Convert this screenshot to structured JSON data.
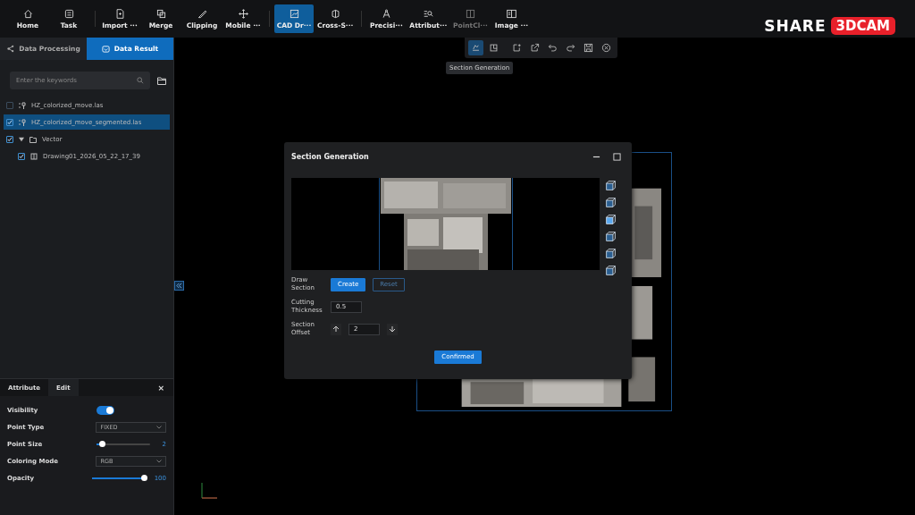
{
  "toolbar": {
    "groups": [
      {
        "items": [
          {
            "label": "Home",
            "selected": false,
            "disabled": false
          },
          {
            "label": "Task",
            "selected": false,
            "disabled": false
          }
        ]
      },
      {
        "items": [
          {
            "label": "Import ···",
            "selected": false,
            "disabled": false
          },
          {
            "label": "Merge",
            "selected": false,
            "disabled": false
          },
          {
            "label": "Clipping",
            "selected": false,
            "disabled": false
          },
          {
            "label": "Mobile ···",
            "selected": false,
            "disabled": false
          }
        ]
      },
      {
        "items": [
          {
            "label": "CAD Dr···",
            "selected": true,
            "disabled": false
          },
          {
            "label": "Cross-S···",
            "selected": false,
            "disabled": false
          }
        ]
      },
      {
        "items": [
          {
            "label": "Precisi···",
            "selected": false,
            "disabled": false
          },
          {
            "label": "Attribut···",
            "selected": false,
            "disabled": false
          },
          {
            "label": "PointCl···",
            "selected": false,
            "disabled": true
          },
          {
            "label": "Image ···",
            "selected": false,
            "disabled": false
          }
        ]
      }
    ]
  },
  "logo": {
    "name": "SHARE",
    "badge": "3DCAM"
  },
  "left_panel": {
    "tabs": [
      {
        "label": "Data Processing",
        "selected": false
      },
      {
        "label": "Data Result",
        "selected": true
      }
    ],
    "search": {
      "placeholder": "Enter the keywords"
    },
    "tree": [
      {
        "label": "HZ_colorized_move.las",
        "kind": "cloud",
        "checked": false,
        "selected": false
      },
      {
        "label": "HZ_colorized_move_segmented.las",
        "kind": "cloud",
        "checked": true,
        "selected": true
      },
      {
        "label": "Vector",
        "kind": "folder",
        "checked": true,
        "selected": false,
        "expanded": true,
        "children": [
          {
            "label": "Drawing01_2026_05_22_17_39",
            "kind": "drawing",
            "checked": true,
            "selected": false
          }
        ]
      }
    ]
  },
  "properties": {
    "tabs": [
      {
        "label": "Attribute",
        "selected": false
      },
      {
        "label": "Edit",
        "selected": true
      }
    ],
    "close": "×",
    "rows": [
      {
        "label": "Visibility",
        "kind": "toggle",
        "on": true
      },
      {
        "label": "Point Type",
        "kind": "select",
        "value": "FIXED"
      },
      {
        "label": "Point Size",
        "kind": "slider",
        "level": 0.1,
        "reading": "2"
      },
      {
        "label": "Coloring Mode",
        "kind": "select",
        "value": "RGB"
      },
      {
        "label": "Opacity",
        "kind": "slider",
        "level": 1,
        "reading": "100"
      }
    ]
  },
  "float_toolbar": {
    "tooltip": "Section Generation",
    "buttons": [
      {
        "selected": true
      },
      {
        "selected": false
      },
      {
        "selected": false
      },
      {
        "selected": false
      },
      {
        "selected": false
      },
      {
        "selected": false
      },
      {
        "selected": false
      },
      {
        "selected": false
      }
    ]
  },
  "dialog": {
    "title": "Section Generation",
    "views": [
      {
        "selected": false
      },
      {
        "selected": false
      },
      {
        "selected": true
      },
      {
        "selected": false
      },
      {
        "selected": false
      },
      {
        "selected": false
      }
    ],
    "draw_section": {
      "label": "Draw Section",
      "create": "Create",
      "reset": "Reset"
    },
    "cutting_thickness": {
      "label": "Cutting Thickness",
      "value": "0.5"
    },
    "section_offset": {
      "label": "Section Offset",
      "value": "2"
    },
    "confirm": "Confirmed"
  }
}
